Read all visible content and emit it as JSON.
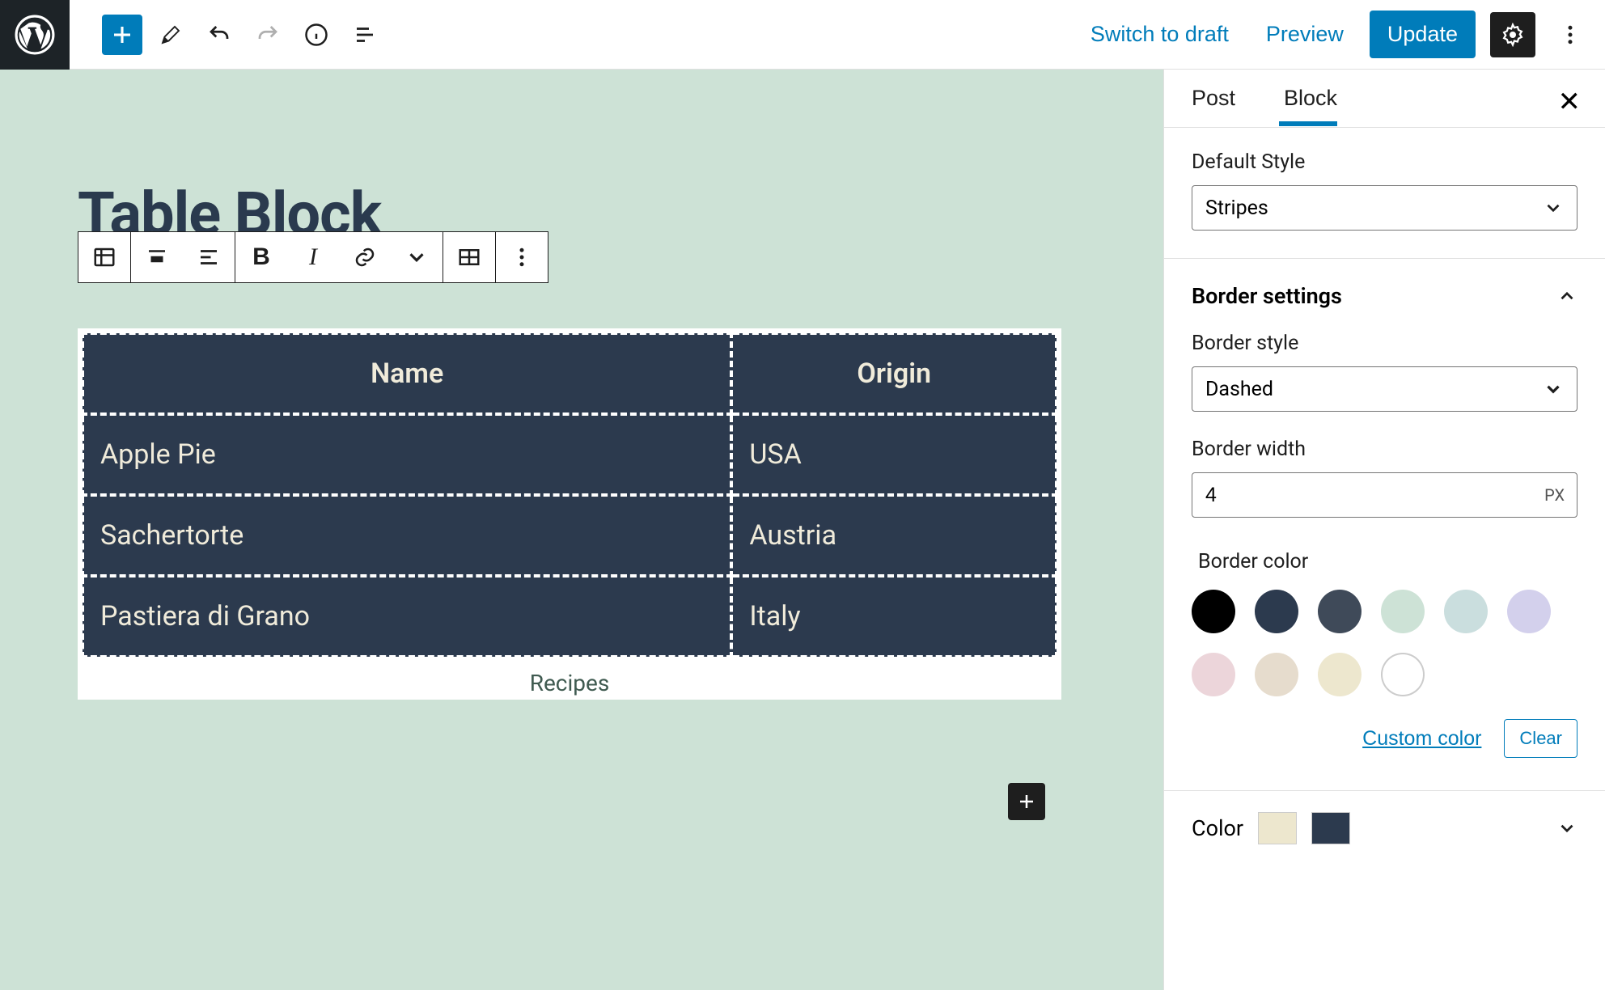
{
  "topbar": {
    "switch_label": "Switch to draft",
    "preview_label": "Preview",
    "update_label": "Update"
  },
  "sidebar": {
    "tabs": {
      "post": "Post",
      "block": "Block"
    },
    "default_style": {
      "label": "Default Style",
      "value": "Stripes"
    },
    "border_settings_label": "Border settings",
    "border_style": {
      "label": "Border style",
      "value": "Dashed"
    },
    "border_width": {
      "label": "Border width",
      "value": "4",
      "unit": "PX"
    },
    "border_color_label": "Border color",
    "swatches": [
      "#000000",
      "#2c3a4e",
      "#3f4a59",
      "#cde2d6",
      "#cadede",
      "#d3d0ec",
      "#ecd5da",
      "#e6dccd",
      "#ede7ce",
      "#ffffff"
    ],
    "custom_label": "Custom color",
    "clear_label": "Clear",
    "color_section": {
      "label": "Color",
      "chip1": "#ede7ce",
      "chip2": "#2c3a4e"
    }
  },
  "editor": {
    "page_title": "Table Block",
    "table": {
      "headers": [
        "Name",
        "Origin"
      ],
      "rows": [
        [
          "Apple Pie",
          "USA"
        ],
        [
          "Sachertorte",
          "Austria"
        ],
        [
          "Pastiera di Grano",
          "Italy"
        ]
      ],
      "caption": "Recipes"
    }
  }
}
